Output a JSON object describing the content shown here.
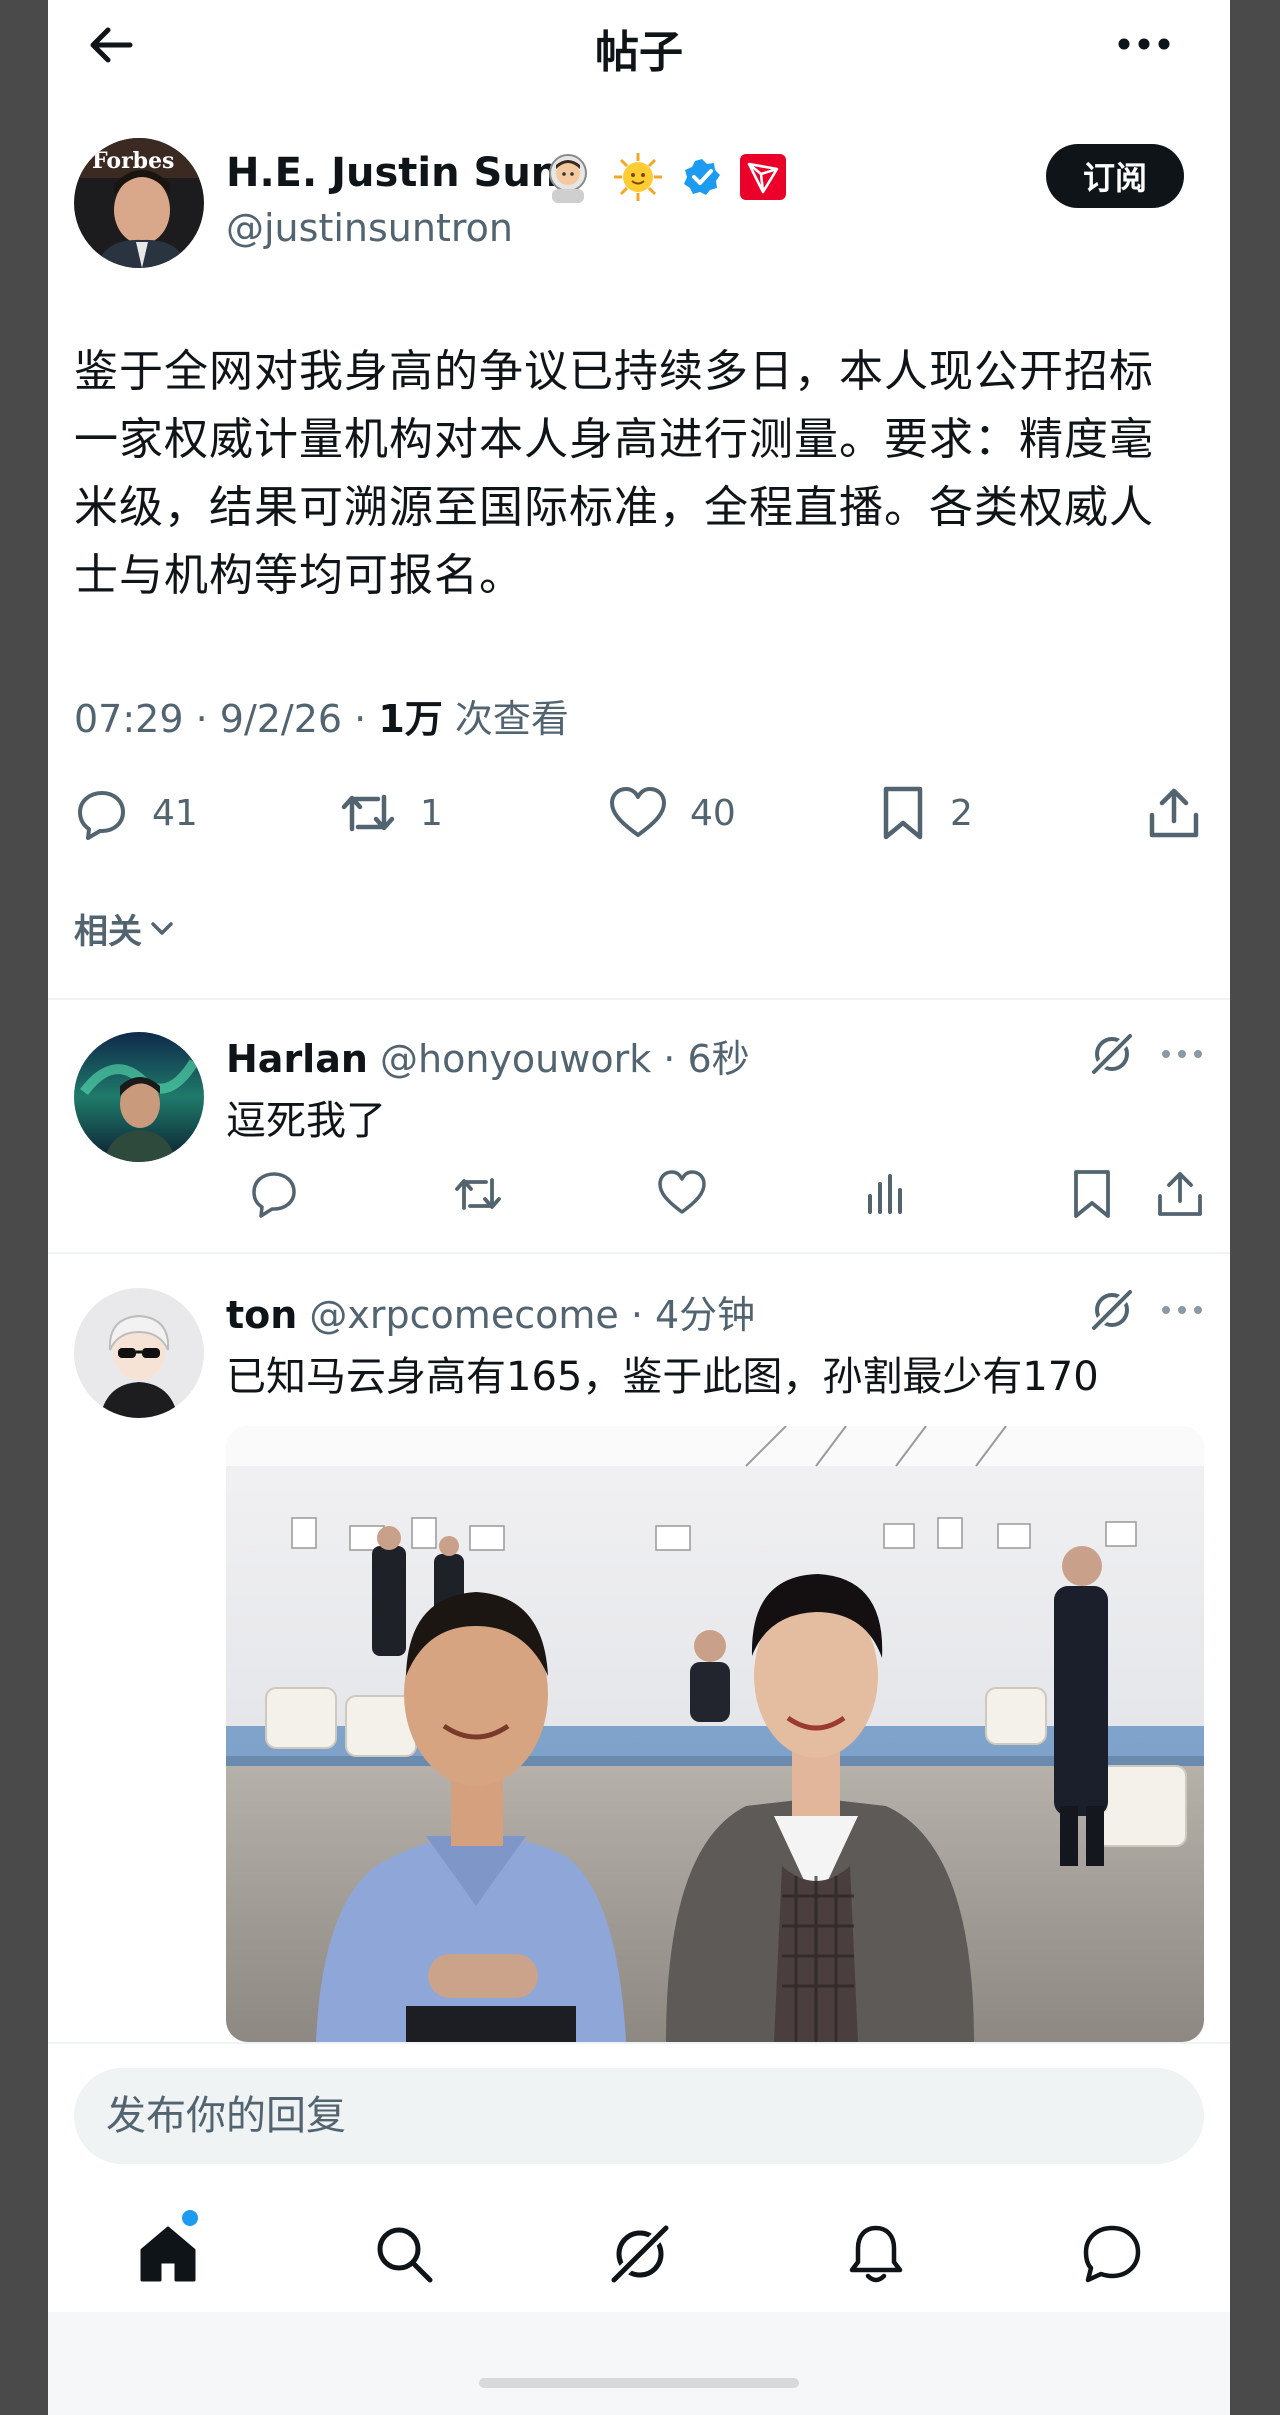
{
  "header": {
    "title": "帖子"
  },
  "post": {
    "author_name": "H.E. Justin Sun",
    "author_handle": "@justinsuntron",
    "avatar_logo_text": "Forbes",
    "subscribe_label": "订阅",
    "text": "鉴于全网对我身高的争议已持续多日，本人现公开招标一家权威计量机构对本人身高进行测量。要求：精度毫米级，结果可溯源至国际标准，全程直播。各类权威人士与机构等均可报名。",
    "time": "07:29",
    "date": "9/2/26",
    "views_count": "1万",
    "views_label": "次查看",
    "replies": "41",
    "reposts": "1",
    "likes": "40",
    "bookmarks": "2",
    "related_label": "相关",
    "badge_icons": [
      "astronaut-emoji",
      "sun-emoji",
      "verified-badge",
      "tron-logo"
    ]
  },
  "replies": [
    {
      "name": "Harlan",
      "handle": "@honyouwork",
      "time": "6秒",
      "text": "逗死我了"
    },
    {
      "name": "ton",
      "handle": "@xrpcomecome",
      "time": "4分钟",
      "text": "已知马云身高有165，鉴于此图，孙割最少有170"
    }
  ],
  "composer": {
    "placeholder": "发布你的回复"
  },
  "tabbar": {
    "items": [
      "home-icon",
      "search-icon",
      "grok-icon",
      "notifications-icon",
      "messages-icon"
    ],
    "accent": "#1d9bf0"
  },
  "colors": {
    "text": "#0f1419",
    "secondary": "#536471",
    "verified": "#1d9bf0",
    "tron": "#eb0029"
  }
}
